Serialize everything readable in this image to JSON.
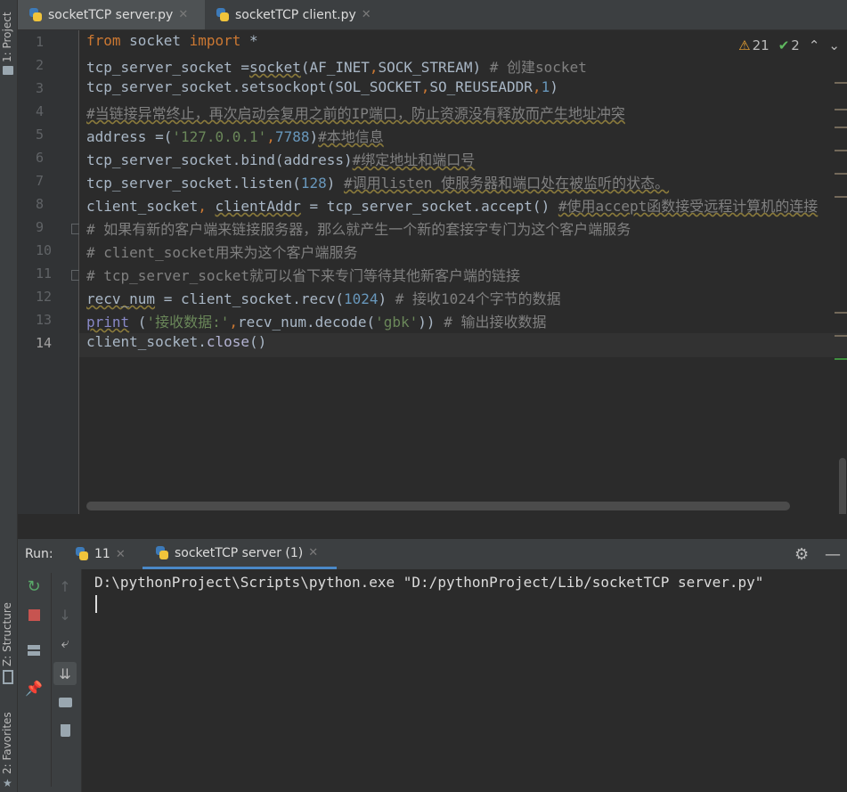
{
  "left_strip": {
    "project_label": "1: Project",
    "structure_label": "Z: Structure",
    "favorites_label": "2: Favorites"
  },
  "tabs": [
    {
      "label": "socketTCP server.py",
      "active": true
    },
    {
      "label": "socketTCP client.py",
      "active": false
    }
  ],
  "inspections": {
    "warnings": "21",
    "typos": "2"
  },
  "editor": {
    "current_line": 14,
    "line_numbers": [
      "1",
      "2",
      "3",
      "4",
      "5",
      "6",
      "7",
      "8",
      "9",
      "10",
      "11",
      "12",
      "13",
      "14"
    ]
  },
  "run": {
    "title": "Run:",
    "tabs": [
      {
        "label": "11",
        "active": false
      },
      {
        "label": "socketTCP server (1)",
        "active": true
      }
    ],
    "console_line": "D:\\pythonProject\\Scripts\\python.exe \"D:/pythonProject/Lib/socketTCP server.py\""
  },
  "colors": {
    "keyword": "#cc7832",
    "string": "#6a8759",
    "number": "#6897bb",
    "comment": "#808080",
    "builtin": "#8888c6"
  },
  "icons": [
    "python-file-icon",
    "close-icon",
    "warning-icon",
    "typo-check-icon",
    "chevron-up-icon",
    "chevron-down-icon",
    "rerun-icon",
    "stop-icon",
    "scroll-up-icon",
    "scroll-down-icon",
    "soft-wrap-icon",
    "scroll-to-end-icon",
    "layout-icon",
    "print-icon",
    "pin-icon",
    "trash-icon",
    "gear-icon",
    "minimize-icon"
  ]
}
